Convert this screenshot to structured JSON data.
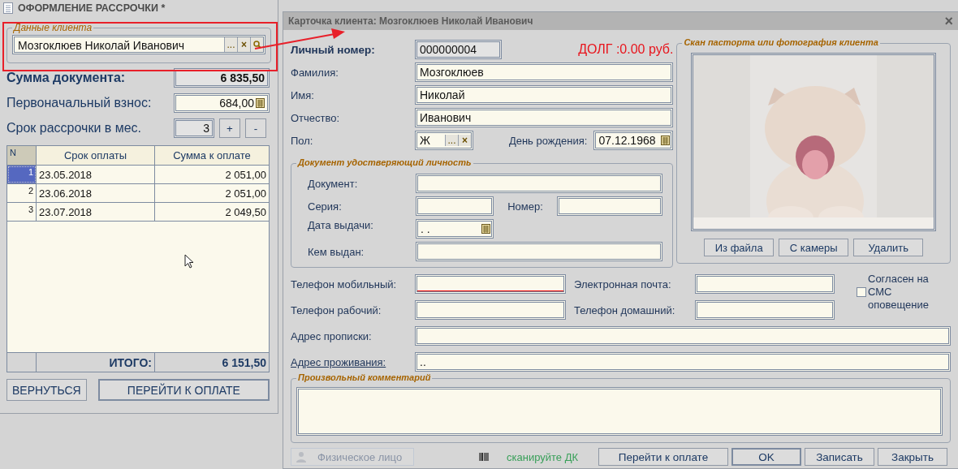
{
  "installment_window": {
    "title": "ОФОРМЛЕНИЕ РАССРОЧКИ *",
    "client_group": {
      "legend": "Данные клиента",
      "value": "Мозгоклюев Николай Иванович",
      "choose": "...",
      "clear": "×"
    },
    "document_sum": {
      "label": "Сумма документа:",
      "value": "6 835,50"
    },
    "down_payment": {
      "label": "Первоначальный взнос:",
      "value": "684,00"
    },
    "term": {
      "label": "Срок рассрочки в мес.",
      "value": "3",
      "increase": "+",
      "decrease": "-"
    },
    "table": {
      "columns": [
        "N",
        "Срок оплаты",
        "Сумма к  оплате"
      ],
      "rows": [
        {
          "n": "1",
          "date": "23.05.2018",
          "amount": "2 051,00",
          "selected": true
        },
        {
          "n": "2",
          "date": "23.06.2018",
          "amount": "2 051,00",
          "selected": false
        },
        {
          "n": "3",
          "date": "23.07.2018",
          "amount": "2 049,50",
          "selected": false
        }
      ],
      "total_label": "ИТОГО:",
      "total": "6 151,50"
    },
    "buttons": [
      "ВЕРНУТЬСЯ",
      "ПЕРЕЙТИ К ОПЛАТЕ"
    ]
  },
  "client_card": {
    "title": "Карточка клиента: Мозгоклюев Николай Иванович",
    "close": "×",
    "personal_number": {
      "label": "Личный номер:",
      "value": "000000004"
    },
    "debt": "ДОЛГ :0.00 руб.",
    "surname": {
      "label": "Фамилия:",
      "value": "Мозгоклюев"
    },
    "first_name": {
      "label": "Имя:",
      "value": "Николай"
    },
    "patronymic": {
      "label": "Отчество:",
      "value": "Иванович"
    },
    "gender": {
      "label": "Пол:",
      "value": "Ж",
      "choose": "...",
      "clear": "×"
    },
    "birthday": {
      "label": "День рождения:",
      "value": "07.12.1968"
    },
    "id_document": {
      "legend": "Документ удостверяющий личность",
      "document_label": "Документ:",
      "series_label": "Серия:",
      "number_label": "Номер:",
      "issue_date_label": "Дата выдачи:",
      "issue_date_value": ". .",
      "issued_by_label": "Кем выдан:"
    },
    "photo_group": {
      "legend": "Скан пасторта или фотография клиента",
      "buttons": [
        "Из файла",
        "С камеры",
        "Удалить"
      ]
    },
    "mobile_label": "Телефон мобильный:",
    "email_label": "Электронная почта:",
    "work_phone_label": "Телефон рабочий:",
    "home_phone_label": "Телефон домашний:",
    "sms_consent": {
      "label": "Согласен на СМС оповещение",
      "checked": false
    },
    "registration_address_label": "Адрес прописки:",
    "residence_address": {
      "label": "Адрес проживания:",
      "value": ".."
    },
    "comment_legend": "Произвольный комментарий",
    "person_type": "Физическое лицо",
    "scan_hint": "сканируйте ДК",
    "buttons": [
      {
        "label": "Перейти к оплате",
        "default": false
      },
      {
        "label": "OK",
        "default": true
      },
      {
        "label": "Записать",
        "default": false
      },
      {
        "label": "Закрыть",
        "default": false
      }
    ]
  }
}
